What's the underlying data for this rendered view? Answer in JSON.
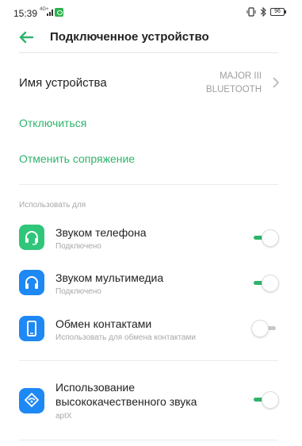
{
  "status_bar": {
    "time": "15:39",
    "network": "4G+",
    "battery": "96"
  },
  "header": {
    "title": "Подключенное устройство"
  },
  "device": {
    "label": "Имя устройства",
    "value_line1": "MAJOR III",
    "value_line2": "BLUETOOTH"
  },
  "actions": {
    "disconnect": "Отключиться",
    "unpair": "Отменить сопряжение"
  },
  "section": {
    "title": "Использовать для"
  },
  "profiles": [
    {
      "title": "Звуком телефона",
      "subtitle": "Подключено",
      "enabled": true,
      "icon": "headset-icon",
      "icon_color": "#2fc67a"
    },
    {
      "title": "Звуком мультимедиа",
      "subtitle": "Подключено",
      "enabled": true,
      "icon": "headphones-icon",
      "icon_color": "#1e88f5"
    },
    {
      "title": "Обмен контактами",
      "subtitle": "Использовать для обмена контактами",
      "enabled": false,
      "icon": "phone-icon",
      "icon_color": "#1e88f5"
    },
    {
      "title_line1": "Использование",
      "title_line2": "высококачественного звука",
      "subtitle": "aptX",
      "enabled": true,
      "icon": "hq-audio-icon",
      "icon_color": "#1e88f5"
    }
  ],
  "colors": {
    "accent": "#2fb36b",
    "blue": "#1e88f5"
  }
}
